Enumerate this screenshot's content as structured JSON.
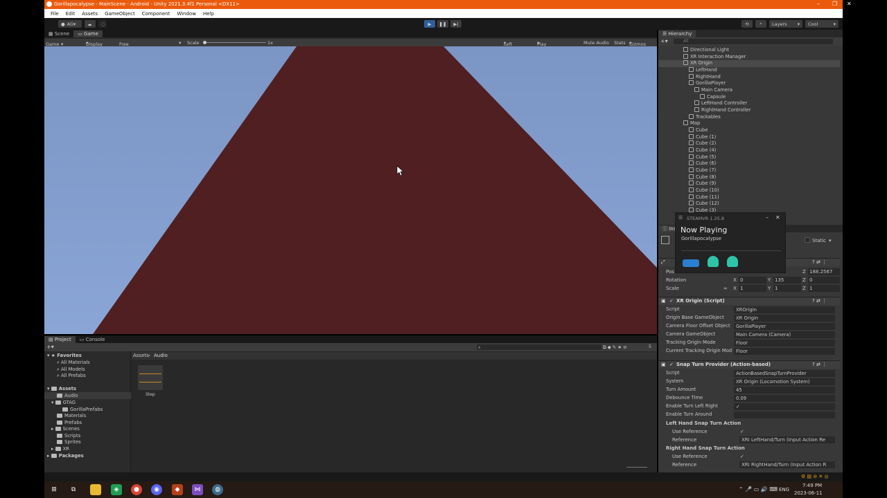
{
  "window": {
    "title": "Gorillapocalypse - MainScene - Android - Unity 2021.3.4f1 Personal <DX11>"
  },
  "menu": [
    "File",
    "Edit",
    "Assets",
    "GameObject",
    "Component",
    "Window",
    "Help"
  ],
  "toolbar": {
    "account": "AG",
    "layers": "Layers",
    "layout": "Cool"
  },
  "game_tabs": {
    "scene": "Scene",
    "game": "Game"
  },
  "game_controls": {
    "view": "Game",
    "display": "Display 1",
    "aspect": "Free Aspect",
    "scale_label": "Scale",
    "scale_value": "1x",
    "eye": "Left Eye",
    "play_mode": "Play Focused",
    "mute": "Mute Audio",
    "stats": "Stats",
    "gizmos": "Gizmos"
  },
  "colors": {
    "sky": "#7b95c4",
    "wall": "#4f1f22",
    "accent": "#eb5a0c"
  },
  "hierarchy": {
    "title": "Hierarchy",
    "search_placeholder": "All",
    "items": [
      {
        "label": "Directional Light",
        "indent": 3
      },
      {
        "label": "XR Interaction Manager",
        "indent": 3
      },
      {
        "label": "XR Origin",
        "indent": 3,
        "selected": true
      },
      {
        "label": "LeftHand",
        "indent": 4
      },
      {
        "label": "RightHand",
        "indent": 4
      },
      {
        "label": "GorillaPlayer",
        "indent": 4
      },
      {
        "label": "Main Camera",
        "indent": 5
      },
      {
        "label": "Capsule",
        "indent": 6
      },
      {
        "label": "LeftHand Controller",
        "indent": 5
      },
      {
        "label": "RightHand Controller",
        "indent": 5
      },
      {
        "label": "Trackables",
        "indent": 4
      },
      {
        "label": "Map",
        "indent": 3
      },
      {
        "label": "Cube",
        "indent": 4
      },
      {
        "label": "Cube (1)",
        "indent": 4
      },
      {
        "label": "Cube (2)",
        "indent": 4
      },
      {
        "label": "Cube (4)",
        "indent": 4
      },
      {
        "label": "Cube (5)",
        "indent": 4
      },
      {
        "label": "Cube (6)",
        "indent": 4
      },
      {
        "label": "Cube (7)",
        "indent": 4
      },
      {
        "label": "Cube (8)",
        "indent": 4
      },
      {
        "label": "Cube (9)",
        "indent": 4
      },
      {
        "label": "Cube (10)",
        "indent": 4
      },
      {
        "label": "Cube (11)",
        "indent": 4
      },
      {
        "label": "Cube (12)",
        "indent": 4
      },
      {
        "label": "Cube (3)",
        "indent": 4
      }
    ]
  },
  "inspector": {
    "tab": "Ins",
    "static_label": "Static",
    "transform": {
      "pos_label": "Pos",
      "pos_z": "188.2567",
      "rot_label": "Rotation",
      "rot_x": "0",
      "rot_y": "135",
      "rot_z": "0",
      "scale_label": "Scale",
      "scale_x": "1",
      "scale_y": "1",
      "scale_z": "1"
    },
    "xr_origin": {
      "title": "XR Origin (Script)",
      "rows": [
        {
          "label": "Script",
          "value": "XROrigin"
        },
        {
          "label": "Origin Base GameObject",
          "value": "XR Origin"
        },
        {
          "label": "Camera Floor Offset Object",
          "value": "GorillaPlayer"
        },
        {
          "label": "Camera GameObject",
          "value": "Main Camera (Camera)"
        },
        {
          "label": "Tracking Origin Mode",
          "value": "Floor"
        },
        {
          "label": "Current Tracking Origin Mod",
          "value": "Floor"
        }
      ]
    },
    "snap_turn": {
      "title": "Snap Turn Provider (Action-based)",
      "rows": [
        {
          "label": "Script",
          "value": "ActionBasedSnapTurnProvider"
        },
        {
          "label": "System",
          "value": "XR Origin (Locomotion System)"
        },
        {
          "label": "Turn Amount",
          "value": "45"
        },
        {
          "label": "Debounce Time",
          "value": "0.09"
        },
        {
          "label": "Enable Turn Left Right",
          "value": "✓"
        },
        {
          "label": "Enable Turn Around",
          "value": ""
        }
      ],
      "left_section": "Left Hand Snap Turn Action",
      "left_use_ref": "Use Reference",
      "left_ref_label": "Reference",
      "left_ref": "XRI LeftHand/Turn (Input Action Re",
      "right_section": "Right Hand Snap Turn Action",
      "right_use_ref": "Use Reference",
      "right_ref_label": "Reference",
      "right_ref": "XRI RightHand/Turn (Input Action R"
    }
  },
  "project": {
    "tabs": {
      "project": "Project",
      "console": "Console"
    },
    "breadcrumb": [
      "Assets",
      "Audio"
    ],
    "favorites_label": "Favorites",
    "favorites": [
      "All Materials",
      "All Models",
      "All Prefabs"
    ],
    "assets_label": "Assets",
    "folders": [
      "Audio",
      "GTAG",
      "GorillaPrefabs",
      "Materials",
      "Prefabs",
      "Scenes",
      "Scripts",
      "Sprites",
      "XR"
    ],
    "packages_label": "Packages",
    "asset_items": [
      {
        "name": "Step"
      }
    ],
    "count": "5"
  },
  "steamvr": {
    "header": "STEAMVR 1.25.8",
    "title": "Now Playing",
    "game": "Gorillapocalypse"
  },
  "taskbar": {
    "lang": "ENG",
    "time": "7:49 PM",
    "date": "2023-06-11"
  }
}
